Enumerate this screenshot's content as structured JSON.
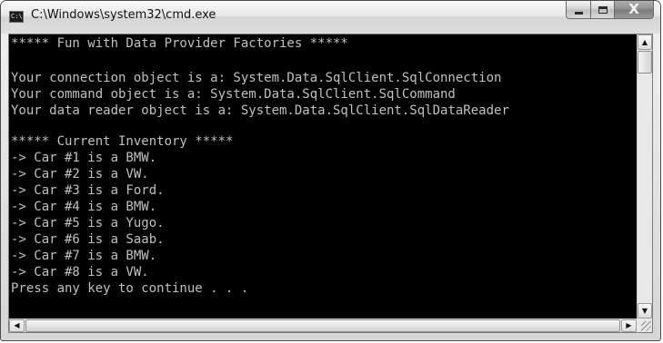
{
  "window": {
    "title": "C:\\Windows\\system32\\cmd.exe",
    "app_icon_label": "C:\\",
    "controls": {
      "minimize_icon": "minimize-icon",
      "maximize_icon": "maximize-icon",
      "close_icon": "close-icon",
      "close_glyph": "X"
    }
  },
  "console": {
    "colors": {
      "background": "#000000",
      "text": "#c0c0c0"
    },
    "lines": [
      "***** Fun with Data Provider Factories *****",
      "",
      "Your connection object is a: System.Data.SqlClient.SqlConnection",
      "Your command object is a: System.Data.SqlClient.SqlCommand",
      "Your data reader object is a: System.Data.SqlClient.SqlDataReader",
      "",
      "***** Current Inventory *****",
      "-> Car #1 is a BMW.",
      "-> Car #2 is a VW.",
      "-> Car #3 is a Ford.",
      "-> Car #4 is a BMW.",
      "-> Car #5 is a Yugo.",
      "-> Car #6 is a Saab.",
      "-> Car #7 is a BMW.",
      "-> Car #8 is a VW.",
      "Press any key to continue . . ."
    ]
  },
  "scrollbars": {
    "up_arrow": "▲",
    "down_arrow": "▼",
    "left_arrow": "◀",
    "right_arrow": "▶"
  }
}
